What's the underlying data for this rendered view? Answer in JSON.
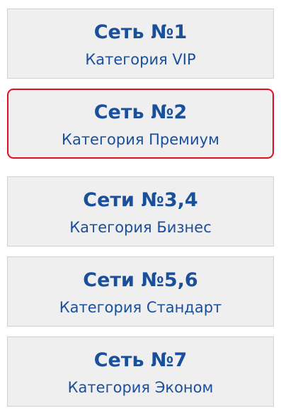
{
  "colors": {
    "text": "#1a4f9c",
    "card_background": "#efefef",
    "card_border": "#d0d0d0",
    "selected_border": "#e01024"
  },
  "networks": [
    {
      "title": "Сеть №1",
      "category": "Категория VIP",
      "selected": false
    },
    {
      "title": "Сеть №2",
      "category": "Категория Премиум",
      "selected": true
    },
    {
      "title": "Сети №3,4",
      "category": "Категория Бизнес",
      "selected": false
    },
    {
      "title": "Сети №5,6",
      "category": "Категория Стандарт",
      "selected": false
    },
    {
      "title": "Сеть №7",
      "category": "Категория Эконом",
      "selected": false
    }
  ]
}
